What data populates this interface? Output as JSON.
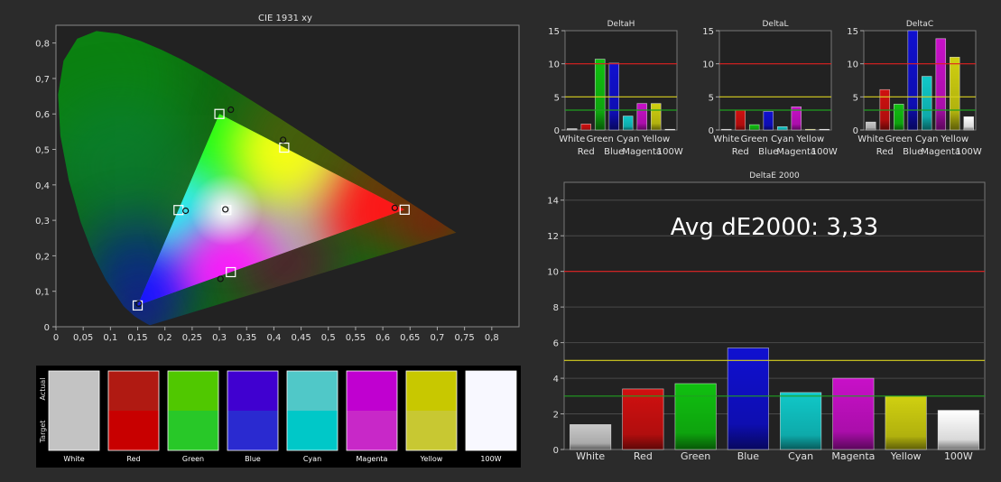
{
  "colors": {
    "background": "#2b2b2b",
    "plot_bg": "#222222",
    "grid": "#555555",
    "axis": "#aaaaaa",
    "text": "#e0e0e0",
    "line_red": "#e02020",
    "line_yellow": "#d8d020",
    "line_green": "#20a020"
  },
  "cie": {
    "title": "CIE 1931 xy",
    "x_ticks": [
      "0",
      "0,05",
      "0,1",
      "0,15",
      "0,2",
      "0,25",
      "0,3",
      "0,35",
      "0,4",
      "0,45",
      "0,5",
      "0,55",
      "0,6",
      "0,65",
      "0,7",
      "0,75",
      "0,8"
    ],
    "y_ticks": [
      "0",
      "0,1",
      "0,2",
      "0,3",
      "0,4",
      "0,5",
      "0,6",
      "0,7",
      "0,8"
    ],
    "targets": [
      {
        "name": "Red",
        "x": 0.64,
        "y": 0.33
      },
      {
        "name": "Green",
        "x": 0.3,
        "y": 0.6
      },
      {
        "name": "Blue",
        "x": 0.15,
        "y": 0.06
      },
      {
        "name": "White",
        "x": 0.3127,
        "y": 0.329
      },
      {
        "name": "Cyan",
        "x": 0.225,
        "y": 0.329
      },
      {
        "name": "Magenta",
        "x": 0.321,
        "y": 0.154
      },
      {
        "name": "Yellow",
        "x": 0.419,
        "y": 0.505
      }
    ],
    "actuals": [
      {
        "name": "Red",
        "x": 0.622,
        "y": 0.335
      },
      {
        "name": "Green",
        "x": 0.321,
        "y": 0.612
      },
      {
        "name": "Blue",
        "x": 0.152,
        "y": 0.065
      },
      {
        "name": "White",
        "x": 0.311,
        "y": 0.331
      },
      {
        "name": "Cyan",
        "x": 0.238,
        "y": 0.327
      },
      {
        "name": "Magenta",
        "x": 0.302,
        "y": 0.135
      },
      {
        "name": "Yellow",
        "x": 0.417,
        "y": 0.527
      }
    ]
  },
  "swatches": {
    "row_actual": "Actual",
    "row_target": "Target",
    "items": [
      {
        "label": "White",
        "actual": "#c3c3c3",
        "target": "#c3c3c3"
      },
      {
        "label": "Red",
        "actual": "#b01a12",
        "target": "#c80000"
      },
      {
        "label": "Green",
        "actual": "#50c800",
        "target": "#28c828"
      },
      {
        "label": "Blue",
        "actual": "#4000d0",
        "target": "#2a2ad0"
      },
      {
        "label": "Cyan",
        "actual": "#50c8c8",
        "target": "#00c8c8"
      },
      {
        "label": "Magenta",
        "actual": "#c000d0",
        "target": "#c828c8"
      },
      {
        "label": "Yellow",
        "actual": "#c8c800",
        "target": "#c8c832"
      },
      {
        "label": "100W",
        "actual": "#f8f8ff",
        "target": "#f8f8ff"
      }
    ]
  },
  "chart_data": [
    {
      "type": "bar",
      "title": "DeltaH",
      "categories": [
        "White",
        "Red",
        "Green",
        "Blue",
        "Cyan",
        "Magenta",
        "Yellow",
        "100W"
      ],
      "values": [
        0.2,
        0.9,
        10.7,
        10.1,
        2.1,
        4.0,
        4.0,
        0.1
      ],
      "ylim": [
        0,
        15
      ],
      "yticks": [
        "0",
        "5",
        "10",
        "15"
      ],
      "thresholds": [
        3,
        5,
        10
      ]
    },
    {
      "type": "bar",
      "title": "DeltaL",
      "categories": [
        "White",
        "Red",
        "Green",
        "Blue",
        "Cyan",
        "Magenta",
        "Yellow",
        "100W"
      ],
      "values": [
        0.1,
        3.0,
        0.8,
        2.8,
        0.5,
        3.5,
        0.1,
        0.1
      ],
      "ylim": [
        0,
        15
      ],
      "yticks": [
        "0",
        "5",
        "10",
        "15"
      ],
      "thresholds": [
        3,
        5,
        10
      ]
    },
    {
      "type": "bar",
      "title": "DeltaC",
      "categories": [
        "White",
        "Red",
        "Green",
        "Blue",
        "Cyan",
        "Magenta",
        "Yellow",
        "100W"
      ],
      "values": [
        1.2,
        6.1,
        3.9,
        15.0,
        8.1,
        13.8,
        11.0,
        2.0
      ],
      "ylim": [
        0,
        15
      ],
      "yticks": [
        "0",
        "5",
        "10",
        "15"
      ],
      "thresholds": [
        3,
        5,
        10
      ]
    },
    {
      "type": "bar",
      "title": "DeltaE 2000",
      "annotation": "Avg dE2000: 3,33",
      "categories": [
        "White",
        "Red",
        "Green",
        "Blue",
        "Cyan",
        "Magenta",
        "Yellow",
        "100W"
      ],
      "values": [
        1.4,
        3.4,
        3.7,
        5.7,
        3.2,
        4.0,
        3.0,
        2.2
      ],
      "ylim": [
        0,
        15
      ],
      "yticks": [
        "0",
        "2",
        "4",
        "6",
        "8",
        "10",
        "12",
        "14"
      ],
      "thresholds": [
        3,
        5,
        10
      ]
    }
  ],
  "bar_colors": [
    "#c8c8c8",
    "#d01010",
    "#10c010",
    "#1010d0",
    "#10c8c8",
    "#c810c8",
    "#d0d010",
    "#ffffff"
  ]
}
